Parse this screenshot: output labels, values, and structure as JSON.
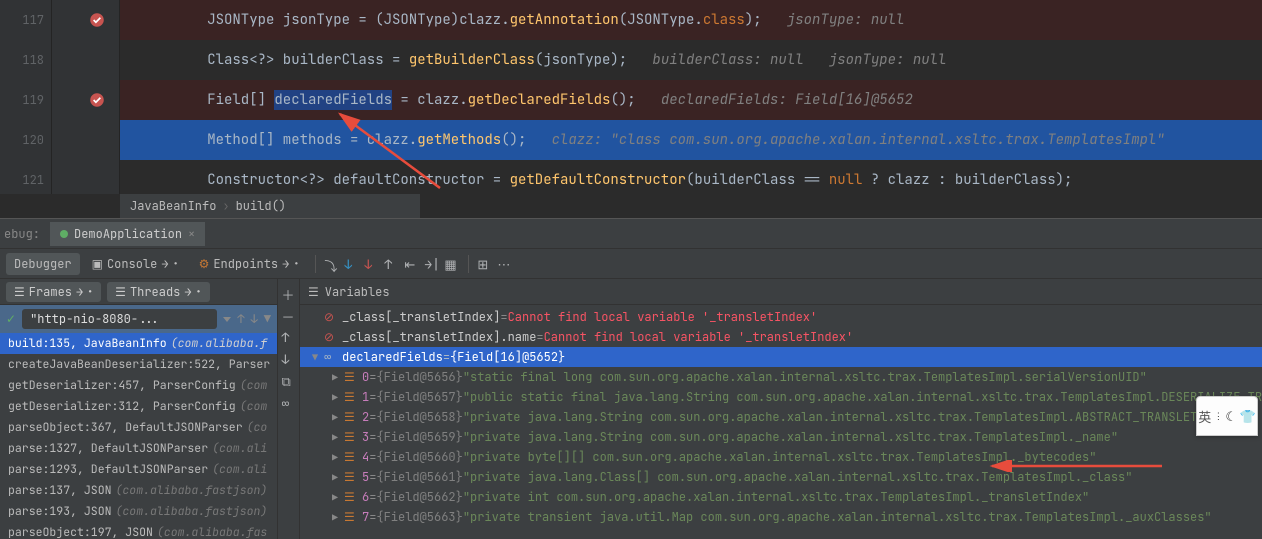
{
  "editor": {
    "lines": [
      {
        "n": "117",
        "bp": true,
        "bg": "bp-line"
      },
      {
        "n": "118"
      },
      {
        "n": "119",
        "bp": true,
        "bg": "bp-line"
      },
      {
        "n": "120",
        "bg": "exec-line"
      },
      {
        "n": "121"
      }
    ],
    "code": {
      "l117_a": "JSONType jsonType = (JSONType)clazz.",
      "l117_b": "getAnnotation",
      "l117_c": "(JSONType.",
      "l117_d": "class",
      "l117_e": ");",
      "l117_f": "   jsonType: null",
      "l118_a": "Class<?> builderClass = ",
      "l118_b": "getBuilderClass",
      "l118_c": "(jsonType);",
      "l118_d": "   builderClass: null   jsonType: null",
      "l119_a": "Field[] ",
      "l119_b": "declaredFields",
      "l119_c": " = clazz.",
      "l119_d": "getDeclaredFields",
      "l119_e": "();",
      "l119_f": "   declaredFields: Field[16]@5652",
      "l120_a": "Method[] methods = clazz.",
      "l120_b": "getMethods",
      "l120_c": "();",
      "l120_d": "   clazz: \"class com.sun.org.apache.xalan.internal.xsltc.trax.TemplatesImpl\"",
      "l121_a": "Constructor<?> defaultConstructor = ",
      "l121_b": "getDefaultConstructor",
      "l121_c": "(builderClass == ",
      "l121_d": "null",
      "l121_e": " ? clazz : builderClass);"
    }
  },
  "breadcrumb": {
    "a": "JavaBeanInfo",
    "b": "build()"
  },
  "debug": {
    "label": "ebug:",
    "run_tab": "DemoApplication",
    "tabs": {
      "debugger": "Debugger",
      "console": "Console",
      "endpoints": "Endpoints"
    },
    "left_tabs": {
      "frames": "Frames",
      "threads": "Threads"
    },
    "thread": "\"http-nio-8080-...",
    "stack": [
      {
        "m": "build:135, JavaBeanInfo",
        "c": "(com.alibaba.f"
      },
      {
        "m": "createJavaBeanDeserializer:522, Parser",
        "c": ""
      },
      {
        "m": "getDeserializer:457, ParserConfig",
        "c": "(com"
      },
      {
        "m": "getDeserializer:312, ParserConfig",
        "c": "(com"
      },
      {
        "m": "parseObject:367, DefaultJSONParser",
        "c": "(co"
      },
      {
        "m": "parse:1327, DefaultJSONParser",
        "c": "(com.ali"
      },
      {
        "m": "parse:1293, DefaultJSONParser",
        "c": "(com.ali"
      },
      {
        "m": "parse:137, JSON",
        "c": "(com.alibaba.fastjson)"
      },
      {
        "m": "parse:193, JSON",
        "c": "(com.alibaba.fastjson)"
      },
      {
        "m": "parseObject:197, JSON",
        "c": "(com.alibaba.fas"
      }
    ],
    "var_hdr": "Variables",
    "errors": [
      {
        "name": "_class[_transletIndex]",
        "msg": "Cannot find local variable '_transletIndex'"
      },
      {
        "name": "_class[_transletIndex].name",
        "msg": "Cannot find local variable '_transletIndex'"
      }
    ],
    "sel_var": {
      "name": "declaredFields",
      "val": "{Field[16]@5652}"
    },
    "fields": [
      {
        "i": "0",
        "ref": "{Field@5656}",
        "v": "\"static final long com.sun.org.apache.xalan.internal.xsltc.trax.TemplatesImpl.serialVersionUID\""
      },
      {
        "i": "1",
        "ref": "{Field@5657}",
        "v": "\"public static final java.lang.String com.sun.org.apache.xalan.internal.xsltc.trax.TemplatesImpl.DESERIALIZE_TRANSLET\""
      },
      {
        "i": "2",
        "ref": "{Field@5658}",
        "v": "\"private java.lang.String com.sun.org.apache.xalan.internal.xsltc.trax.TemplatesImpl.ABSTRACT_TRANSLET\""
      },
      {
        "i": "3",
        "ref": "{Field@5659}",
        "v": "\"private java.lang.String com.sun.org.apache.xalan.internal.xsltc.trax.TemplatesImpl._name\""
      },
      {
        "i": "4",
        "ref": "{Field@5660}",
        "v": "\"private byte[][] com.sun.org.apache.xalan.internal.xsltc.trax.TemplatesImpl._bytecodes\""
      },
      {
        "i": "5",
        "ref": "{Field@5661}",
        "v": "\"private java.lang.Class[] com.sun.org.apache.xalan.internal.xsltc.trax.TemplatesImpl._class\""
      },
      {
        "i": "6",
        "ref": "{Field@5662}",
        "v": "\"private int com.sun.org.apache.xalan.internal.xsltc.trax.TemplatesImpl._transletIndex\""
      },
      {
        "i": "7",
        "ref": "{Field@5663}",
        "v": "\"private transient java.util.Map com.sun.org.apache.xalan.internal.xsltc.trax.TemplatesImpl._auxClasses\""
      }
    ]
  },
  "ime": {
    "lang": "英",
    "moon": "☾",
    "shirt": "👕"
  }
}
